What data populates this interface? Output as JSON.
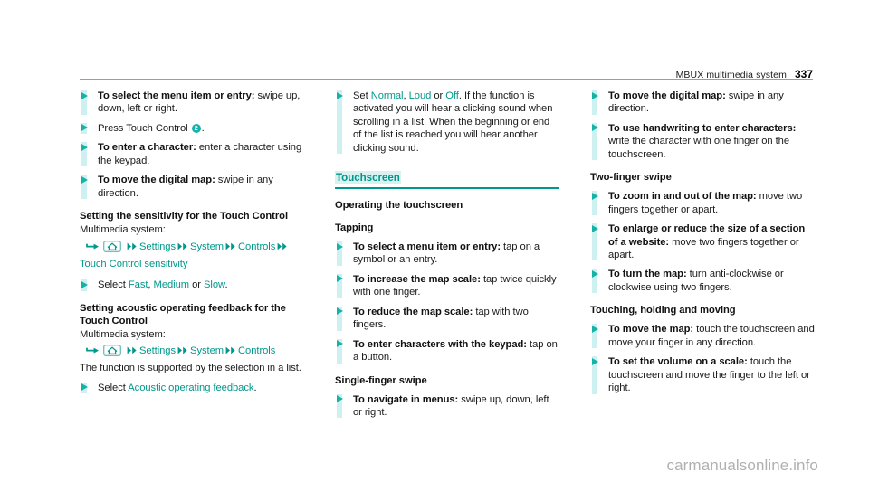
{
  "header": {
    "title": "MBUX multimedia system",
    "page_number": "337",
    "rule_color": "#8fa3a6"
  },
  "theme": {
    "teal": "#00978c",
    "teal_bright": "#15b2a8",
    "teal_tint": "#cdf1f0",
    "heading_tint": "#d9f2f0"
  },
  "watermark": "carmanualsonline.info",
  "columns": [
    {
      "id": "column-1",
      "blocks": [
        {
          "kind": "bullet",
          "name": "bullet-select-menu-item",
          "bold": "To select the menu item or entry:",
          "rest": " swipe up, down, left or right."
        },
        {
          "kind": "bullet-callout",
          "name": "bullet-press-touch-control",
          "pre": "Press Touch Control ",
          "callout": "2",
          "post": "."
        },
        {
          "kind": "bullet",
          "name": "bullet-enter-character",
          "bold": "To enter a character:",
          "rest": " enter a character using the keypad."
        },
        {
          "kind": "bullet",
          "name": "bullet-move-digital-map",
          "bold": "To move the digital map:",
          "rest": " swipe in any direction."
        },
        {
          "kind": "subhead",
          "name": "subhead-setting-sensitivity",
          "text": "Setting the sensitivity for the Touch Control"
        },
        {
          "kind": "para",
          "name": "para-multimedia-system-1",
          "text": "Multimedia system:"
        },
        {
          "kind": "navpath",
          "name": "navpath-touch-control-sensitivity",
          "items": [
            "Settings",
            "System",
            "Controls",
            "Touch Control sensitivity"
          ]
        },
        {
          "kind": "bullet-options",
          "name": "bullet-select-speed",
          "pre": "Select ",
          "options": [
            "Fast",
            "Medium",
            "Slow"
          ],
          "sep1": ", ",
          "sep2": " or ",
          "post": "."
        },
        {
          "kind": "subhead",
          "name": "subhead-setting-acoustic-feedback",
          "text": "Setting acoustic operating feedback for the Touch Control"
        },
        {
          "kind": "para",
          "name": "para-multimedia-system-2",
          "text": "Multimedia system:"
        },
        {
          "kind": "navpath",
          "name": "navpath-controls",
          "items": [
            "Settings",
            "System",
            "Controls"
          ]
        },
        {
          "kind": "para",
          "name": "para-function-supported",
          "text": "The function is supported by the selection in a list."
        },
        {
          "kind": "bullet-options",
          "name": "bullet-select-acoustic-feedback",
          "pre": "Select ",
          "options": [
            "Acoustic operating feedback"
          ],
          "sep1": "",
          "sep2": "",
          "post": "."
        }
      ]
    },
    {
      "id": "column-2",
      "blocks": [
        {
          "kind": "bullet-options-multiline",
          "name": "bullet-set-normal-loud-off",
          "pre": "Set ",
          "options": [
            "Normal",
            "Loud",
            "Off"
          ],
          "sep1": ", ",
          "sep2": " or ",
          "post": ".",
          "extra": "If the function is activated you will hear a clicking sound when scrolling in a list. When the beginning or end of the list is reached you will hear another clicking sound."
        },
        {
          "kind": "section",
          "name": "section-touchscreen",
          "text": "Touchscreen"
        },
        {
          "kind": "subhead",
          "name": "subhead-operating-touchscreen",
          "text": "Operating the touchscreen"
        },
        {
          "kind": "subhead",
          "name": "subhead-tapping",
          "text": "Tapping"
        },
        {
          "kind": "bullet",
          "name": "bullet-select-menu-item-tap",
          "bold": "To select a menu item or entry:",
          "rest": " tap on a symbol or an entry."
        },
        {
          "kind": "bullet",
          "name": "bullet-increase-map-scale",
          "bold": "To increase the map scale:",
          "rest": " tap twice quickly with one finger."
        },
        {
          "kind": "bullet",
          "name": "bullet-reduce-map-scale",
          "bold": "To reduce the map scale:",
          "rest": " tap with two fingers."
        },
        {
          "kind": "bullet",
          "name": "bullet-enter-characters-keypad",
          "bold": "To enter characters with the keypad:",
          "rest": " tap on a button."
        },
        {
          "kind": "subhead",
          "name": "subhead-single-finger-swipe",
          "text": "Single-finger swipe"
        },
        {
          "kind": "bullet",
          "name": "bullet-navigate-in-menus",
          "bold": "To navigate in menus:",
          "rest": " swipe up, down, left or right."
        }
      ]
    },
    {
      "id": "column-3",
      "blocks": [
        {
          "kind": "bullet",
          "name": "bullet-move-digital-map-2",
          "bold": "To move the digital map:",
          "rest": " swipe in any direction."
        },
        {
          "kind": "bullet",
          "name": "bullet-handwriting-characters",
          "bold": "To use handwriting to enter characters:",
          "rest": " write the character with one finger on the touchscreen."
        },
        {
          "kind": "subhead",
          "name": "subhead-two-finger-swipe",
          "text": "Two-finger swipe"
        },
        {
          "kind": "bullet",
          "name": "bullet-zoom-in-out-map",
          "bold": "To zoom in and out of the map:",
          "rest": " move two fingers together or apart."
        },
        {
          "kind": "bullet",
          "name": "bullet-enlarge-reduce-website",
          "bold": "To enlarge or reduce the size of a section of a website:",
          "rest": " move two fingers together or apart."
        },
        {
          "kind": "bullet",
          "name": "bullet-turn-map",
          "bold": "To turn the map:",
          "rest": " turn anti-clockwise or clockwise using two fingers."
        },
        {
          "kind": "subhead",
          "name": "subhead-touching-holding-moving",
          "text": "Touching, holding and moving"
        },
        {
          "kind": "bullet",
          "name": "bullet-move-the-map",
          "bold": "To move the map:",
          "rest": " touch the touchscreen and move your finger in any direction."
        },
        {
          "kind": "bullet",
          "name": "bullet-set-volume-scale",
          "bold": "To set the volume on a scale:",
          "rest": " touch the touchscreen and move the finger to the left or right."
        }
      ]
    }
  ],
  "icons": {
    "nav_arrow": "bent-arrow-right-icon",
    "nav_home": "home-icon",
    "nav_sep": "double-chevron-right-icon",
    "bullet": "triangle-right-icon"
  }
}
